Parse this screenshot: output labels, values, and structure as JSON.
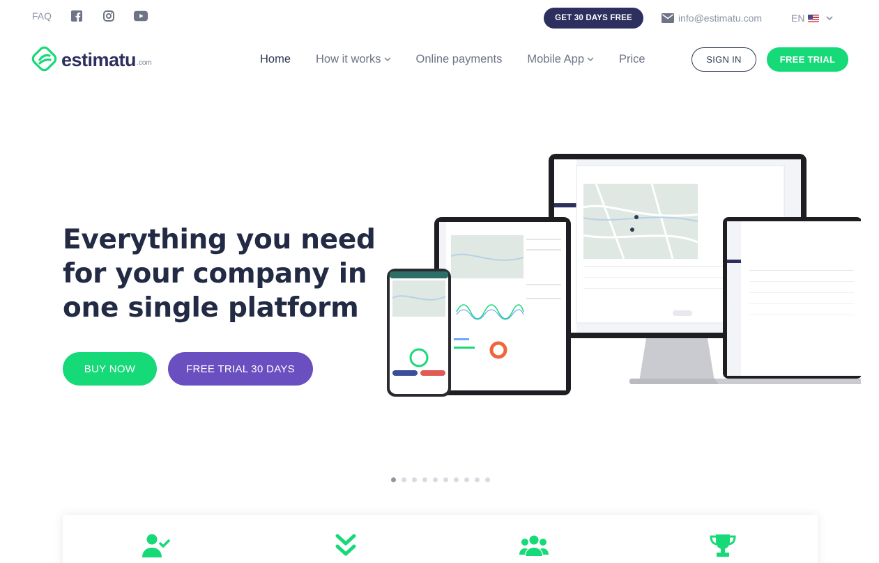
{
  "topbar": {
    "faq_label": "FAQ",
    "social": [
      {
        "icon": "facebook-icon"
      },
      {
        "icon": "instagram-icon"
      },
      {
        "icon": "youtube-icon"
      }
    ],
    "promo_label": "GET 30 DAYS FREE",
    "email": "info@estimatu.com",
    "language": "EN"
  },
  "nav": {
    "logo_text": "estimatu",
    "logo_suffix": ".com",
    "items": [
      {
        "label": "Home",
        "active": true,
        "dropdown": false
      },
      {
        "label": "How it works",
        "active": false,
        "dropdown": true
      },
      {
        "label": "Online payments",
        "active": false,
        "dropdown": false
      },
      {
        "label": "Mobile App",
        "active": false,
        "dropdown": true
      },
      {
        "label": "Price",
        "active": false,
        "dropdown": false
      }
    ],
    "signin_label": "SIGN IN",
    "free_trial_label": "FREE TRIAL"
  },
  "hero": {
    "headline": "Everything you need for your company in one single platform",
    "buy_label": "BUY NOW",
    "trial_label": "FREE TRIAL 30 DAYS"
  },
  "carousel": {
    "slide_count": 10,
    "active_index": 0
  },
  "features": {
    "icons": [
      "user-check-icon",
      "double-chevron-down-icon",
      "users-group-icon",
      "trophy-icon"
    ]
  },
  "colors": {
    "brand_green": "#16d978",
    "brand_navy": "#2d2f5e",
    "brand_purple": "#6a4fc1",
    "text_dark": "#222a44",
    "text_muted": "#6e7486"
  }
}
